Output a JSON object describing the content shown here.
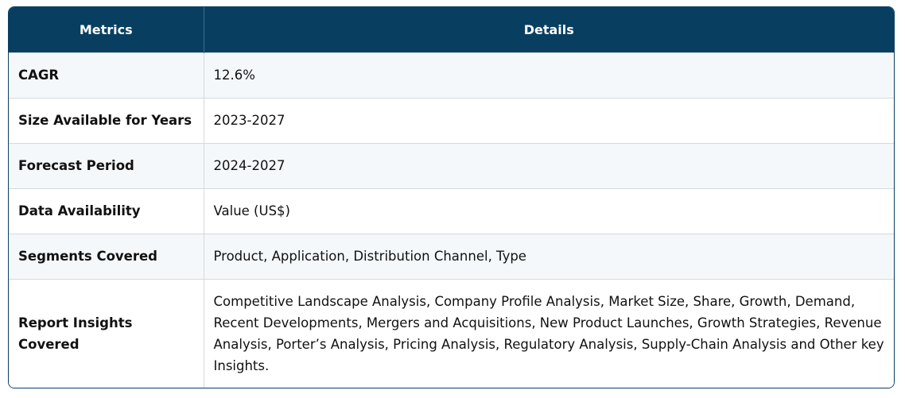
{
  "table": {
    "headers": {
      "metrics": "Metrics",
      "details": "Details"
    },
    "rows": [
      {
        "metric": "CAGR",
        "detail": "12.6%"
      },
      {
        "metric": "Size Available for Years",
        "detail": "2023-2027"
      },
      {
        "metric": "Forecast Period",
        "detail": "2024-2027"
      },
      {
        "metric": "Data Availability",
        "detail": "Value (US$)"
      },
      {
        "metric": "Segments Covered",
        "detail": "Product, Application, Distribution Channel, Type"
      },
      {
        "metric": "Report Insights Covered",
        "detail": "Competitive Landscape Analysis, Company Profile Analysis, Market Size, Share, Growth, Demand, Recent Developments, Mergers and Acquisitions, New Product Launches, Growth Strategies, Revenue Analysis, Porter’s Analysis, Pricing Analysis, Regulatory Analysis, Supply-Chain Analysis and Other key Insights."
      }
    ]
  },
  "colors": {
    "header_bg": "#083f61",
    "header_text": "#ffffff",
    "row_alt_bg": "#f5f8fb",
    "border": "#d4d9de"
  }
}
